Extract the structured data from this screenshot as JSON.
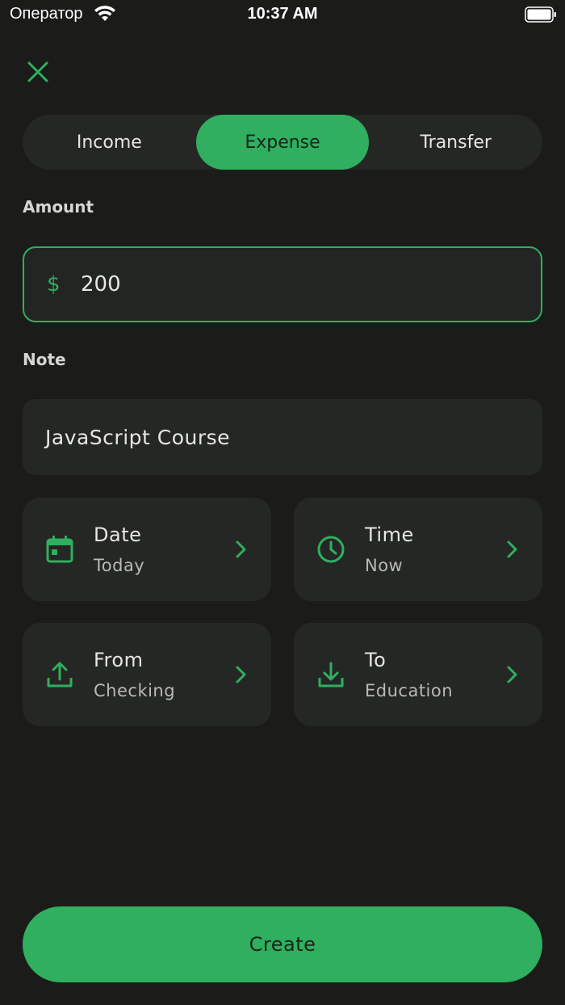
{
  "status_bar": {
    "carrier": "Оператор",
    "time": "10:37 AM"
  },
  "colors": {
    "accent": "#2faf5f",
    "background": "#1b1c1a",
    "surface": "#252724"
  },
  "tabs": [
    {
      "label": "Income",
      "active": false
    },
    {
      "label": "Expense",
      "active": true
    },
    {
      "label": "Transfer",
      "active": false
    }
  ],
  "amount": {
    "label": "Amount",
    "currency_symbol": "$",
    "value": "200"
  },
  "note": {
    "label": "Note",
    "value": "JavaScript Course"
  },
  "cards": {
    "date": {
      "title": "Date",
      "value": "Today",
      "icon": "calendar-icon"
    },
    "time": {
      "title": "Time",
      "value": "Now",
      "icon": "clock-icon"
    },
    "from": {
      "title": "From",
      "value": "Checking",
      "icon": "upload-icon"
    },
    "to": {
      "title": "To",
      "value": "Education",
      "icon": "download-icon"
    }
  },
  "create_label": "Create"
}
